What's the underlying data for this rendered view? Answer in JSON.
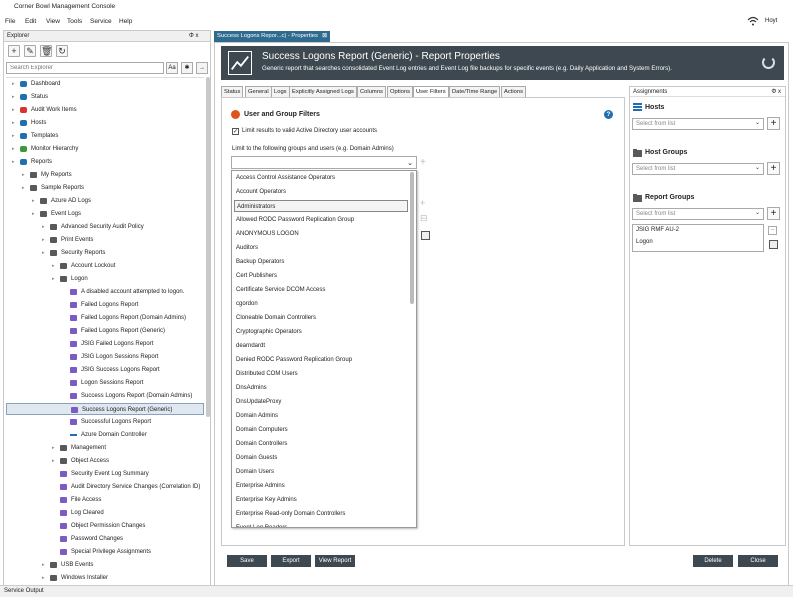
{
  "app": {
    "title": "Corner Bowl Management Console",
    "user": "Hoyt"
  },
  "menu": [
    "File",
    "Edit",
    "View",
    "Tools",
    "Service",
    "Help"
  ],
  "explorer": {
    "title": "Explorer",
    "pin": "Φ x",
    "search_placeholder": "Search Explorer",
    "tree": [
      {
        "label": "Dashboard",
        "level": 0,
        "icon": "dashboard-icon",
        "color": "#1f6fb2"
      },
      {
        "label": "Status",
        "level": 0,
        "icon": "info-icon",
        "color": "#1f6fb2"
      },
      {
        "label": "Audit Work Items",
        "level": 0,
        "icon": "shield-icon",
        "color": "#d9342b"
      },
      {
        "label": "Hosts",
        "level": 0,
        "icon": "hosts-icon",
        "color": "#1f6fb2"
      },
      {
        "label": "Templates",
        "level": 0,
        "icon": "templates-icon",
        "color": "#1f6fb2"
      },
      {
        "label": "Monitor Hierarchy",
        "level": 0,
        "icon": "hierarchy-icon",
        "color": "#3a9a3a"
      },
      {
        "label": "Reports",
        "level": 0,
        "icon": "reports-icon",
        "color": "#1f6fb2"
      },
      {
        "label": "My Reports",
        "level": 1,
        "icon": "folder-icon"
      },
      {
        "label": "Sample Reports",
        "level": 1,
        "icon": "folder-icon"
      },
      {
        "label": "Azure AD Logs",
        "level": 2,
        "icon": "folder-icon"
      },
      {
        "label": "Event Logs",
        "level": 2,
        "icon": "folder-icon"
      },
      {
        "label": "Advanced Security Audit Policy",
        "level": 3,
        "icon": "folder-icon"
      },
      {
        "label": "Print Events",
        "level": 3,
        "icon": "folder-icon"
      },
      {
        "label": "Security Reports",
        "level": 3,
        "icon": "folder-icon"
      },
      {
        "label": "Account Lockout",
        "level": 4,
        "icon": "folder-icon"
      },
      {
        "label": "Logon",
        "level": 4,
        "icon": "folder-icon"
      },
      {
        "label": "A disabled account attempted to logon.",
        "level": 5,
        "icon": "report-icon"
      },
      {
        "label": "Failed Logons Report",
        "level": 5,
        "icon": "report-icon"
      },
      {
        "label": "Failed Logons Report (Domain Admins)",
        "level": 5,
        "icon": "report-icon"
      },
      {
        "label": "Failed Logons Report (Generic)",
        "level": 5,
        "icon": "report-icon"
      },
      {
        "label": "JSIG Failed Logons Report",
        "level": 5,
        "icon": "report-icon"
      },
      {
        "label": "JSIG Logon Sessions Report",
        "level": 5,
        "icon": "report-icon"
      },
      {
        "label": "JSIG Success Logons Report",
        "level": 5,
        "icon": "report-icon"
      },
      {
        "label": "Logon Sessions Report",
        "level": 5,
        "icon": "report-icon"
      },
      {
        "label": "Success Logons Report (Domain Admins)",
        "level": 5,
        "icon": "report-icon"
      },
      {
        "label": "Success Logons Report (Generic)",
        "level": 5,
        "icon": "report-icon",
        "selected": true
      },
      {
        "label": "Successful Logons Report",
        "level": 5,
        "icon": "report-icon"
      },
      {
        "label": "Azure Domain Controller",
        "level": 5,
        "icon": "line-icon"
      },
      {
        "label": "Management",
        "level": 4,
        "icon": "folder-icon"
      },
      {
        "label": "Object Access",
        "level": 4,
        "icon": "folder-icon"
      },
      {
        "label": "Security Event Log Summary",
        "level": 4,
        "icon": "report-icon"
      },
      {
        "label": "Audit Directory Service Changes (Correlation ID)",
        "level": 4,
        "icon": "report-icon"
      },
      {
        "label": "File Access",
        "level": 4,
        "icon": "report-icon"
      },
      {
        "label": "Log Cleared",
        "level": 4,
        "icon": "report-icon"
      },
      {
        "label": "Object Permission Changes",
        "level": 4,
        "icon": "report-icon"
      },
      {
        "label": "Password Changes",
        "level": 4,
        "icon": "report-icon"
      },
      {
        "label": "Special Privilege Assignments",
        "level": 4,
        "icon": "report-icon"
      },
      {
        "label": "USB Events",
        "level": 3,
        "icon": "folder-icon"
      },
      {
        "label": "Windows Installer",
        "level": 3,
        "icon": "folder-icon"
      }
    ]
  },
  "doc_tab": "Success Logons Repor...c) - Properties",
  "header": {
    "title": "Success Logons Report (Generic) - Report Properties",
    "subtitle": "Generic report that searches consolidated Event Log entries and Event Log file backups for specific events (e.g. Daily Application and System Errors)."
  },
  "tabs": [
    "Status",
    "General",
    "Logs",
    "Explicitly Assigned Logs",
    "Columns",
    "Options",
    "User Filters",
    "Date/Time Range",
    "Actions"
  ],
  "active_tab": "User Filters",
  "user_filters": {
    "title": "User and Group Filters",
    "checkbox_label": "Limit results to valid Active Directory user accounts",
    "limit_label": "Limit to the following groups and users (e.g. Domain Admins)",
    "options": [
      "Access Control Assistance Operators",
      "Account Operators",
      "Administrators",
      "Allowed RODC Password Replication Group",
      "ANONYMOUS LOGON",
      "Auditors",
      "Backup Operators",
      "Cert Publishers",
      "Certificate Service DCOM Access",
      "cgordon",
      "Cloneable Domain Controllers",
      "Cryptographic Operators",
      "dearndardt",
      "Denied RODC Password Replication Group",
      "Distributed COM Users",
      "DnsAdmins",
      "DnsUpdateProxy",
      "Domain Admins",
      "Domain Computers",
      "Domain Controllers",
      "Domain Guests",
      "Domain Users",
      "Enterprise Admins",
      "Enterprise Key Admins",
      "Enterprise Read-only Domain Controllers",
      "Event Log Readers"
    ],
    "highlighted": "Administrators"
  },
  "assignments": {
    "title": "Assignments",
    "pin": "Φ x",
    "hosts_label": "Hosts",
    "host_groups_label": "Host Groups",
    "report_groups_label": "Report Groups",
    "select_placeholder": "Select from list",
    "report_group_items": [
      "JSIG RMF AU-2",
      "Logon"
    ]
  },
  "buttons": {
    "save": "Save",
    "export": "Export",
    "view_report": "View Report",
    "delete": "Delete",
    "close": "Close"
  },
  "status_bar": "Service Output"
}
